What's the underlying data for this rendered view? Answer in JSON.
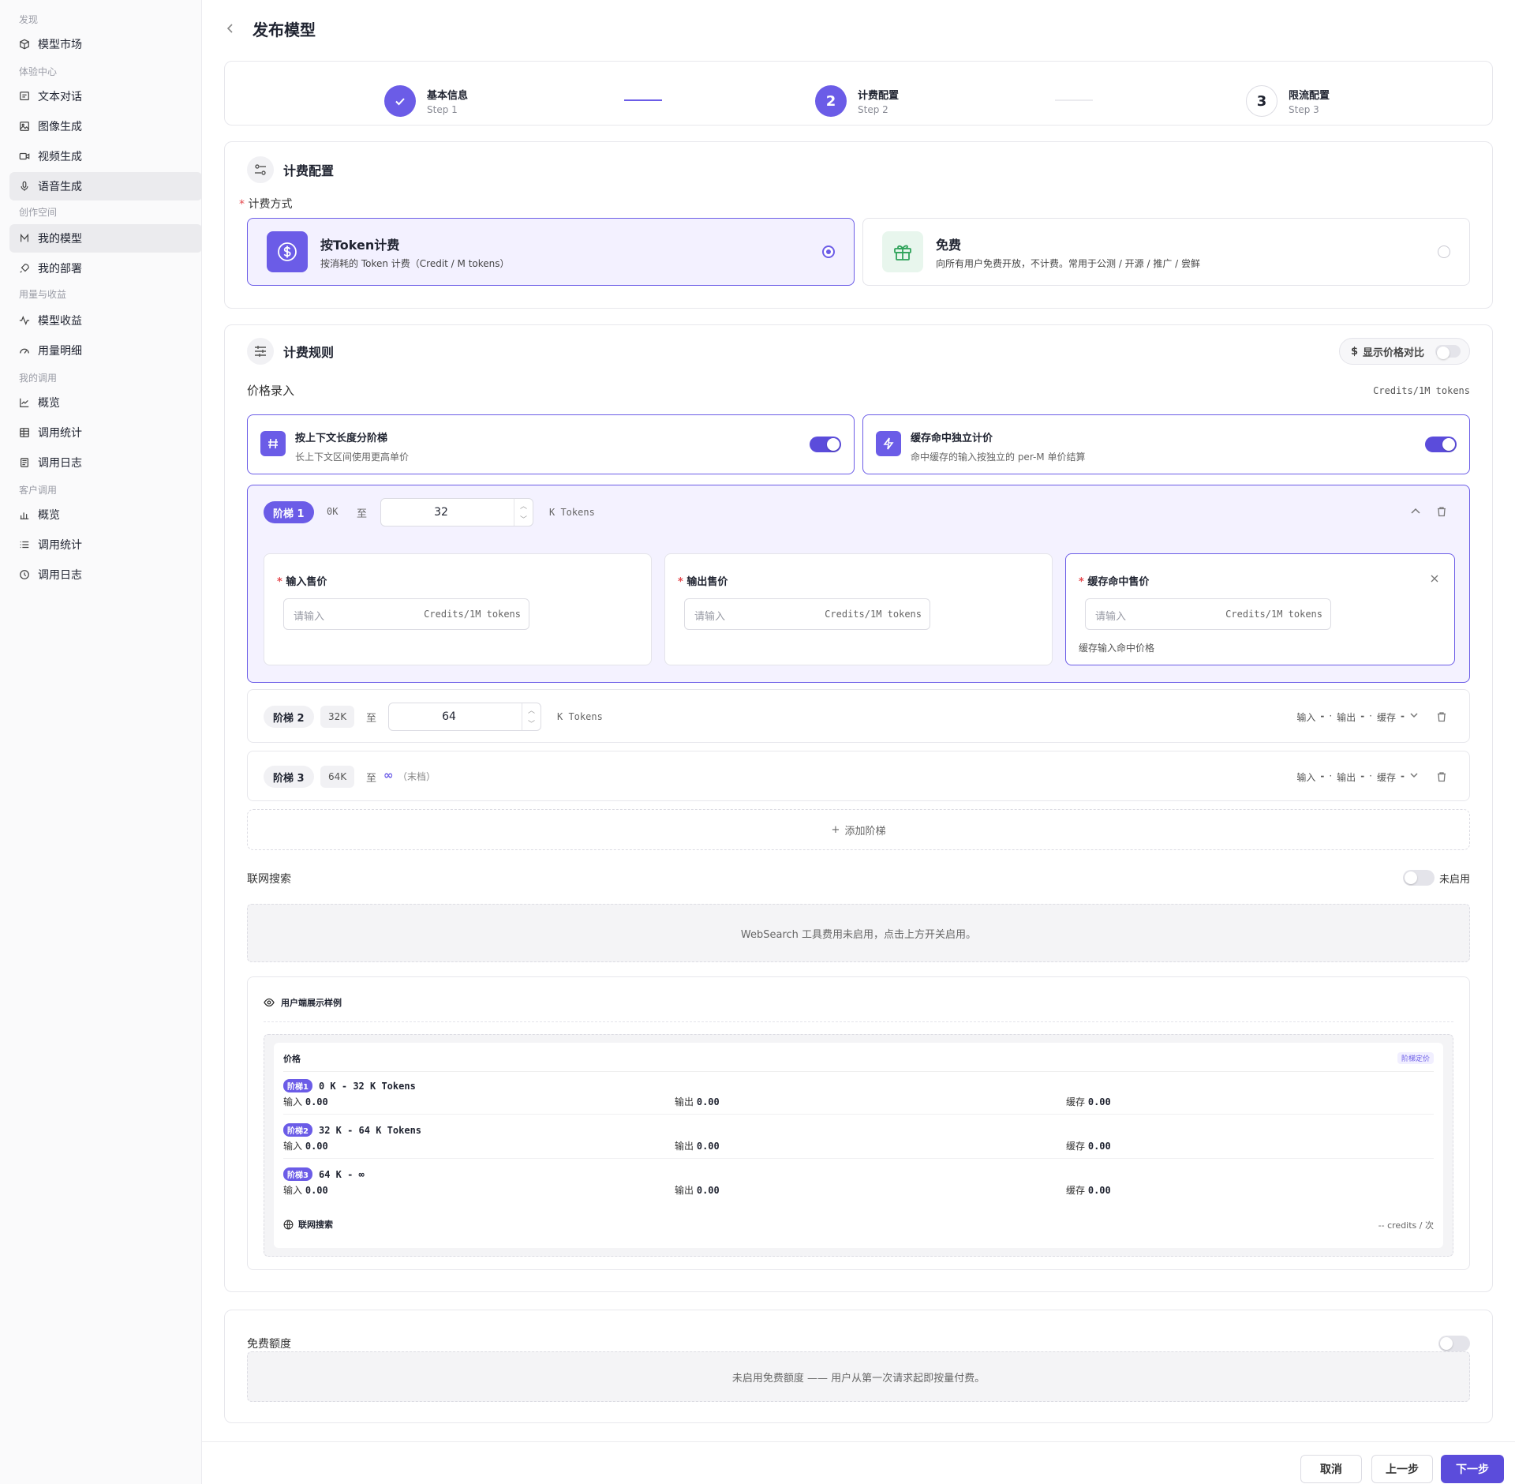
{
  "sidebar": {
    "groups": [
      "发现",
      "体验中心",
      "创作空间",
      "用量与收益",
      "我的调用",
      "客户调用"
    ],
    "items": [
      {
        "label": "模型市场",
        "icon": "box-icon"
      },
      {
        "label": "文本对话",
        "icon": "chat-icon"
      },
      {
        "label": "图像生成",
        "icon": "image-icon"
      },
      {
        "label": "视频生成",
        "icon": "video-icon"
      },
      {
        "label": "语音生成",
        "icon": "mic-icon"
      },
      {
        "label": "我的模型",
        "icon": "model-icon"
      },
      {
        "label": "我的部署",
        "icon": "rocket-icon"
      },
      {
        "label": "模型收益",
        "icon": "activity-icon"
      },
      {
        "label": "用量明细",
        "icon": "gauge-icon"
      },
      {
        "label": "概览",
        "icon": "chart-icon"
      },
      {
        "label": "调用统计",
        "icon": "table-icon"
      },
      {
        "label": "调用日志",
        "icon": "log-icon"
      },
      {
        "label": "概览",
        "icon": "bar-icon"
      },
      {
        "label": "调用统计",
        "icon": "list-icon"
      },
      {
        "label": "调用日志",
        "icon": "history-icon"
      }
    ]
  },
  "header": {
    "title": "发布模型"
  },
  "steps": [
    {
      "title": "基本信息",
      "sub": "Step 1",
      "status": "done"
    },
    {
      "title": "计费配置",
      "sub": "Step 2",
      "num": "2",
      "status": "current"
    },
    {
      "title": "限流配置",
      "sub": "Step 3",
      "num": "3",
      "status": "pending"
    }
  ],
  "billing": {
    "title": "计费配置",
    "method_label": "计费方式",
    "options": [
      {
        "title": "按Token计费",
        "desc": "按消耗的 Token 计费（Credit / M tokens）"
      },
      {
        "title": "免费",
        "desc": "向所有用户免费开放，不计费。常用于公测 / 开源 / 推广 / 尝鲜"
      }
    ]
  },
  "rules": {
    "title": "计费规则",
    "compare_label": "显示价格对比",
    "price_entry": "价格录入",
    "unit": "Credits/1M tokens",
    "tiered": {
      "title": "按上下文长度分阶梯",
      "desc": "长上下文区间使用更高单价"
    },
    "cache": {
      "title": "缓存命中独立计价",
      "desc": "命中缓存的输入按独立的 per-M 单价结算"
    },
    "to_label": "至",
    "k_tokens": "K Tokens",
    "tiers": [
      {
        "name": "阶梯 1",
        "from": "0K",
        "to": "32"
      },
      {
        "name": "阶梯 2",
        "from": "32K",
        "to": "64"
      },
      {
        "name": "阶梯 3",
        "from": "64K",
        "infinity": "∞",
        "last": "（末档）"
      }
    ],
    "price_boxes": [
      {
        "title": "输入售价",
        "placeholder": "请输入",
        "unit": "Credits/1M tokens"
      },
      {
        "title": "输出售价",
        "placeholder": "请输入",
        "unit": "Credits/1M tokens"
      },
      {
        "title": "缓存命中售价",
        "placeholder": "请输入",
        "unit": "Credits/1M tokens",
        "hint": "缓存输入命中价格"
      }
    ],
    "summary": {
      "input": "输入",
      "output": "输出",
      "cache": "缓存",
      "dash": "-",
      "dot": "·"
    },
    "add_tier": "添加阶梯"
  },
  "websearch": {
    "title": "联网搜索",
    "status": "未启用",
    "placeholder": "WebSearch 工具费用未启用，点击上方开关启用。"
  },
  "preview": {
    "title": "用户端展示样例",
    "price_label": "价格",
    "badge": "阶梯定价",
    "rows": [
      {
        "pill": "阶梯1",
        "range": "0 K - 32 K Tokens",
        "input": "0.00",
        "output": "0.00",
        "cache": "0.00"
      },
      {
        "pill": "阶梯2",
        "range": "32 K - 64 K Tokens",
        "input": "0.00",
        "output": "0.00",
        "cache": "0.00"
      },
      {
        "pill": "阶梯3",
        "range": "64 K - ∞",
        "input": "0.00",
        "output": "0.00",
        "cache": "0.00"
      }
    ],
    "labels": {
      "input": "输入",
      "output": "输出",
      "cache": "缓存"
    },
    "websearch": "联网搜索",
    "websearch_price": "-- credits / 次"
  },
  "free_quota": {
    "title": "免费额度",
    "placeholder": "未启用免费额度 —— 用户从第一次请求起即按量付费。"
  },
  "footer": {
    "cancel": "取消",
    "prev": "上一步",
    "next": "下一步"
  },
  "colors": {
    "accent": "#5b4cdb",
    "accent_light": "#f3f1ff",
    "free_green": "#2fa35a"
  }
}
